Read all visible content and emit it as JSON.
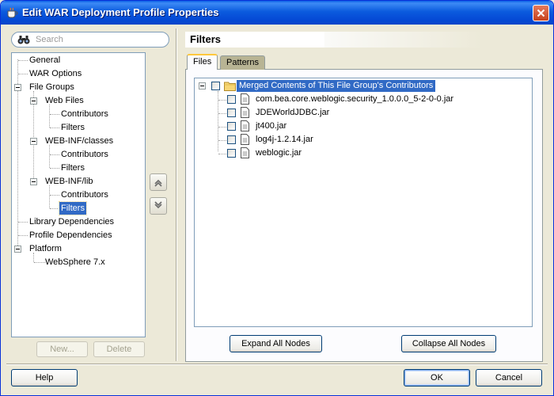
{
  "window": {
    "title": "Edit WAR Deployment Profile Properties"
  },
  "search": {
    "placeholder": "Search"
  },
  "nav_tree": {
    "general": "General",
    "war_options": "WAR Options",
    "file_groups": "File Groups",
    "web_files": "Web Files",
    "web_files_contributors": "Contributors",
    "web_files_filters": "Filters",
    "webinf_classes": "WEB-INF/classes",
    "webinf_classes_contributors": "Contributors",
    "webinf_classes_filters": "Filters",
    "webinf_lib": "WEB-INF/lib",
    "webinf_lib_contributors": "Contributors",
    "webinf_lib_filters": "Filters",
    "library_dependencies": "Library Dependencies",
    "profile_dependencies": "Profile Dependencies",
    "platform": "Platform",
    "websphere": "WebSphere 7.x"
  },
  "nav_buttons": {
    "new": "New...",
    "delete": "Delete"
  },
  "panel": {
    "title": "Filters"
  },
  "tabs": {
    "files": "Files",
    "patterns": "Patterns"
  },
  "file_tree": {
    "root": "Merged Contents of This File Group's Contributors",
    "items": [
      "com.bea.core.weblogic.security_1.0.0.0_5-2-0-0.jar",
      "JDEWorldJDBC.jar",
      "jt400.jar",
      "log4j-1.2.14.jar",
      "weblogic.jar"
    ]
  },
  "file_buttons": {
    "expand": "Expand All Nodes",
    "collapse": "Collapse All Nodes"
  },
  "dialog_buttons": {
    "help": "Help",
    "ok": "OK",
    "cancel": "Cancel"
  },
  "colors": {
    "title_bar": "#0A5FE6",
    "selection": "#316AC5",
    "tab_accent": "#FFC83C"
  }
}
